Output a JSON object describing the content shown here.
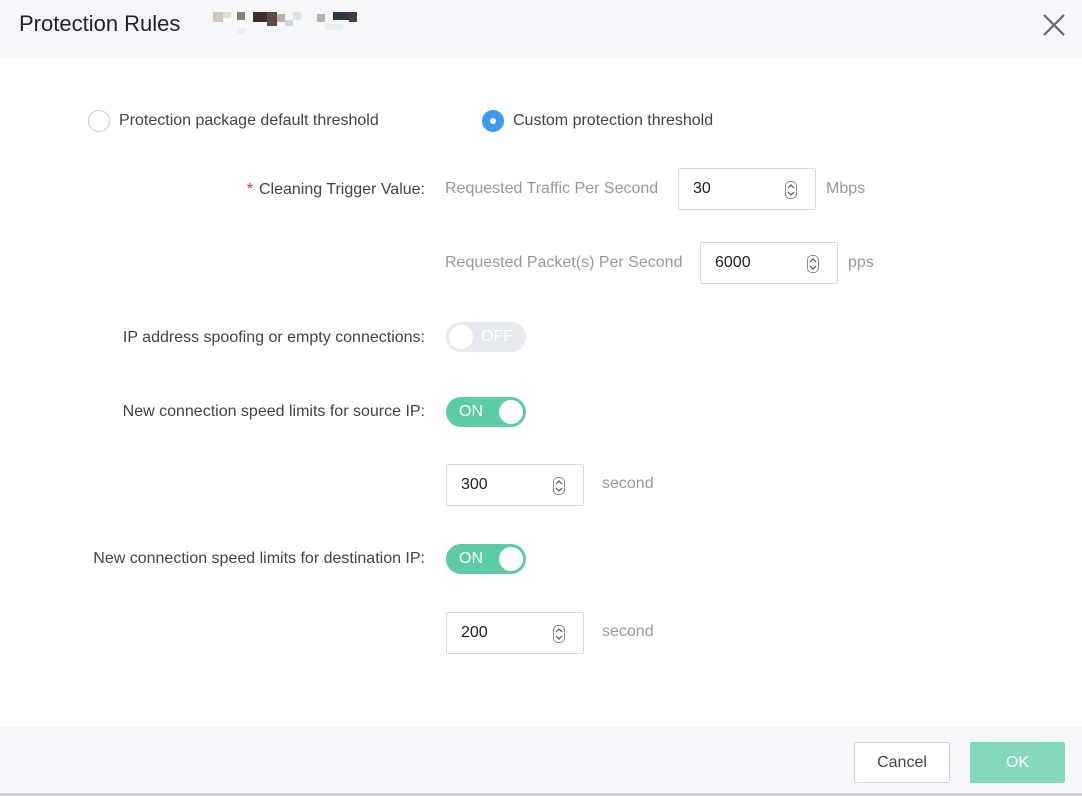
{
  "dialog": {
    "title": "Protection Rules"
  },
  "threshold_options": [
    {
      "label": "Protection package default threshold",
      "checked": false
    },
    {
      "label": "Custom protection threshold",
      "checked": true
    }
  ],
  "cleaning_trigger": {
    "label": "Cleaning Trigger Value:",
    "required_mark": "*",
    "traffic": {
      "label": "Requested Traffic Per Second",
      "value": "30",
      "unit": "Mbps"
    },
    "packets": {
      "label": "Requested Packet(s) Per Second",
      "value": "6000",
      "unit": "pps"
    }
  },
  "ip_spoofing": {
    "label": "IP address spoofing or empty connections:",
    "state": "OFF"
  },
  "source_ip_limit": {
    "label": "New connection speed limits for source IP:",
    "state": "ON",
    "value": "300",
    "unit": "second"
  },
  "dest_ip_limit": {
    "label": "New connection speed limits for destination IP:",
    "state": "ON",
    "value": "200",
    "unit": "second"
  },
  "footer": {
    "cancel_label": "Cancel",
    "ok_label": "OK"
  },
  "colors": {
    "accent_blue": "#3d9af0",
    "toggle_on": "#5ccba7",
    "ok_button": "#83d9bc",
    "required": "#e0312f"
  },
  "icons": {
    "close": "close-icon",
    "spinner": "spinner-arrows-icon"
  }
}
